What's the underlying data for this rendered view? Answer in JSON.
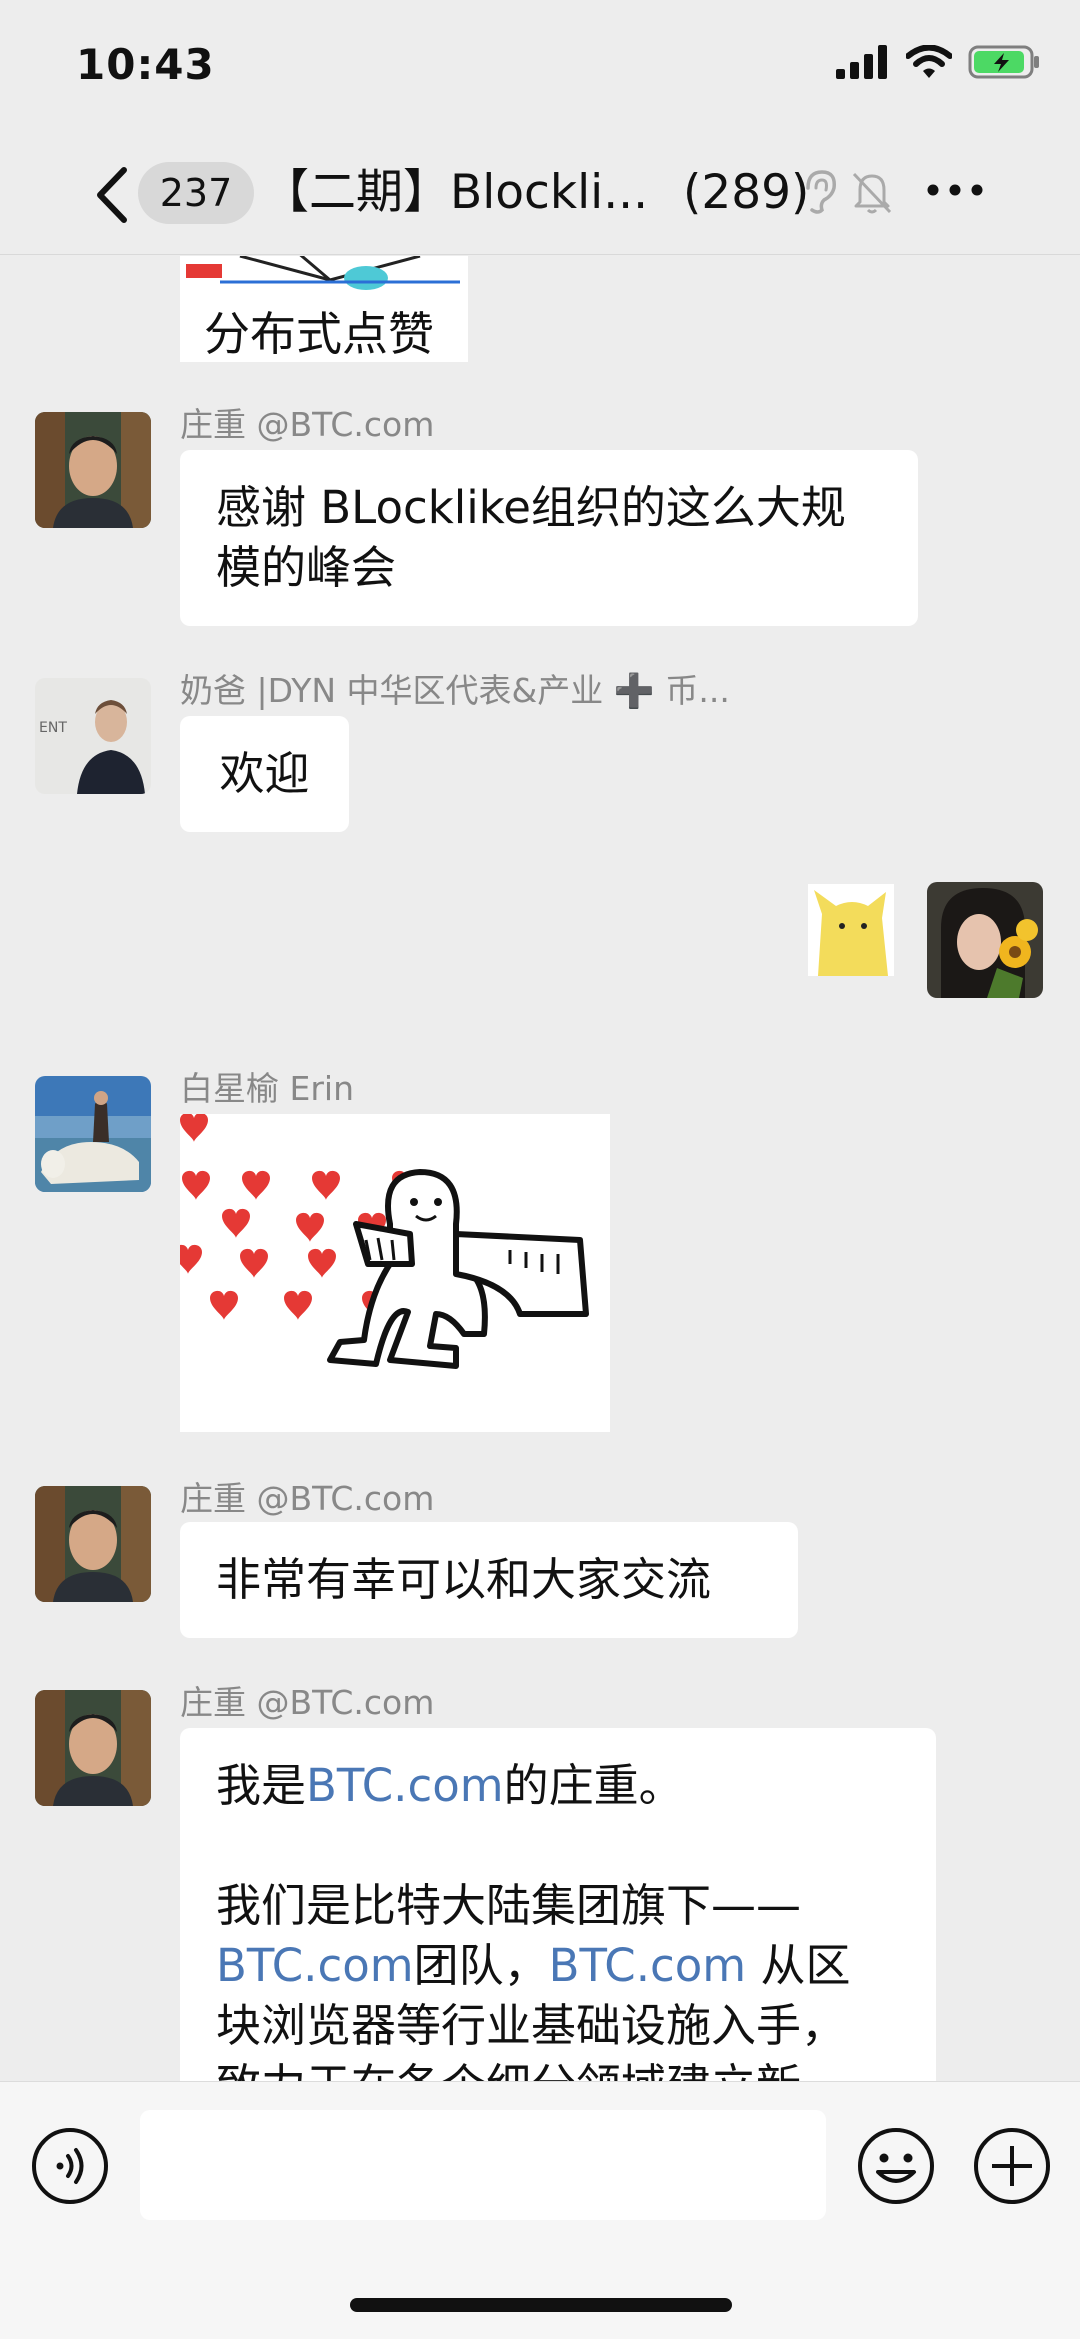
{
  "status_bar": {
    "time": "10:43",
    "battery_color": "#4cd964"
  },
  "nav": {
    "back_icon": "chevron-left-icon",
    "unread_count": "237",
    "title": "【二期】Blockli...",
    "member_count": "(289)",
    "icons": [
      "ear-icon",
      "mute-bell-icon",
      "more-icon"
    ]
  },
  "messages": [
    {
      "type": "image",
      "caption": "分布式点赞"
    },
    {
      "sender": "庄重 @BTC.com",
      "lines": [
        "感谢 BLocklike组织的这么大规",
        "模的峰会"
      ]
    },
    {
      "sender": "奶爸 |DYN 中华区代表&产业 ➕ 币...",
      "text": "欢迎"
    },
    {
      "type": "outgoing-sticker",
      "sticker": "yellow-cat-sticker"
    },
    {
      "sender": "白星榆 Erin",
      "type": "sticker",
      "sticker": "hearts-dancer-sticker"
    },
    {
      "sender": "庄重 @BTC.com",
      "text": "非常有幸可以和大家交流"
    },
    {
      "sender": "庄重 @BTC.com",
      "line1_pre": "我是",
      "line1_link": "BTC.com",
      "line1_post": "的庄重。",
      "line2": "我们是比特大陆集团旗下——",
      "line3_link1": "BTC.com",
      "line3_mid": "团队，",
      "line3_link2": "BTC.com",
      "line3_post": " 从区",
      "line4": "块浏览器等行业基础设施入手，",
      "line5": "致力于在各个细分领域建立新"
    }
  ],
  "colors": {
    "link": "#4a77b5",
    "background": "#ededed",
    "bubble": "#ffffff",
    "heart": "#e53935"
  },
  "input_bar": {
    "voice_icon": "voice-icon",
    "emoji_icon": "emoji-icon",
    "plus_icon": "plus-icon",
    "placeholder": ""
  }
}
